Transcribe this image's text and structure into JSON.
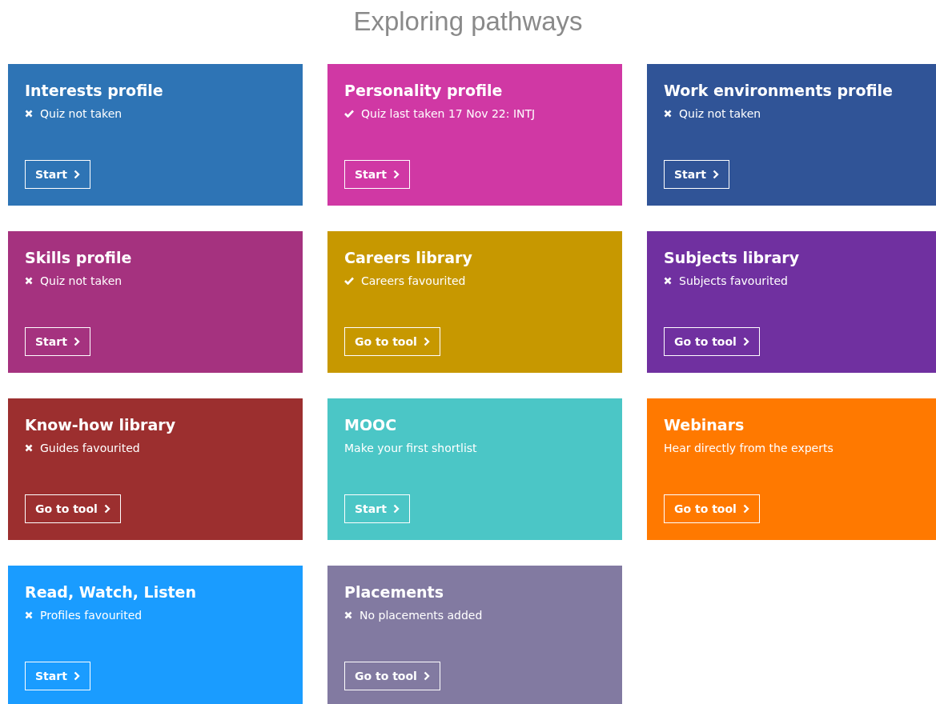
{
  "heading": "Exploring pathways",
  "cards": [
    {
      "title": "Interests profile",
      "color": "#2e74b5",
      "done": false,
      "status": "Quiz not taken",
      "button": "Start"
    },
    {
      "title": "Personality profile",
      "color": "#d038a4",
      "done": true,
      "status": "Quiz last taken 17 Nov 22: INTJ",
      "button": "Start"
    },
    {
      "title": "Work environments profile",
      "color": "#305497",
      "done": false,
      "status": "Quiz not taken",
      "button": "Start"
    },
    {
      "title": "Skills profile",
      "color": "#a5327f",
      "done": false,
      "status": "Quiz not taken",
      "button": "Start"
    },
    {
      "title": "Careers library",
      "color": "#c79800",
      "done": true,
      "status": "Careers favourited",
      "button": "Go to tool"
    },
    {
      "title": "Subjects library",
      "color": "#7030a0",
      "done": false,
      "status": "Subjects favourited",
      "button": "Go to tool"
    },
    {
      "title": "Know-how library",
      "color": "#9c2f2f",
      "done": false,
      "status": "Guides favourited",
      "button": "Go to tool"
    },
    {
      "title": "MOOC",
      "color": "#4bc6c6",
      "status": "Make your first shortlist",
      "button": "Start"
    },
    {
      "title": "Webinars",
      "color": "#ff7900",
      "status": "Hear directly from the experts",
      "button": "Go to tool"
    },
    {
      "title": "Read, Watch, Listen",
      "color": "#1a9cff",
      "done": false,
      "status": "Profiles favourited",
      "button": "Start"
    },
    {
      "title": "Placements",
      "color": "#827aa1",
      "done": false,
      "status": "No placements added",
      "button": "Go to tool"
    }
  ]
}
